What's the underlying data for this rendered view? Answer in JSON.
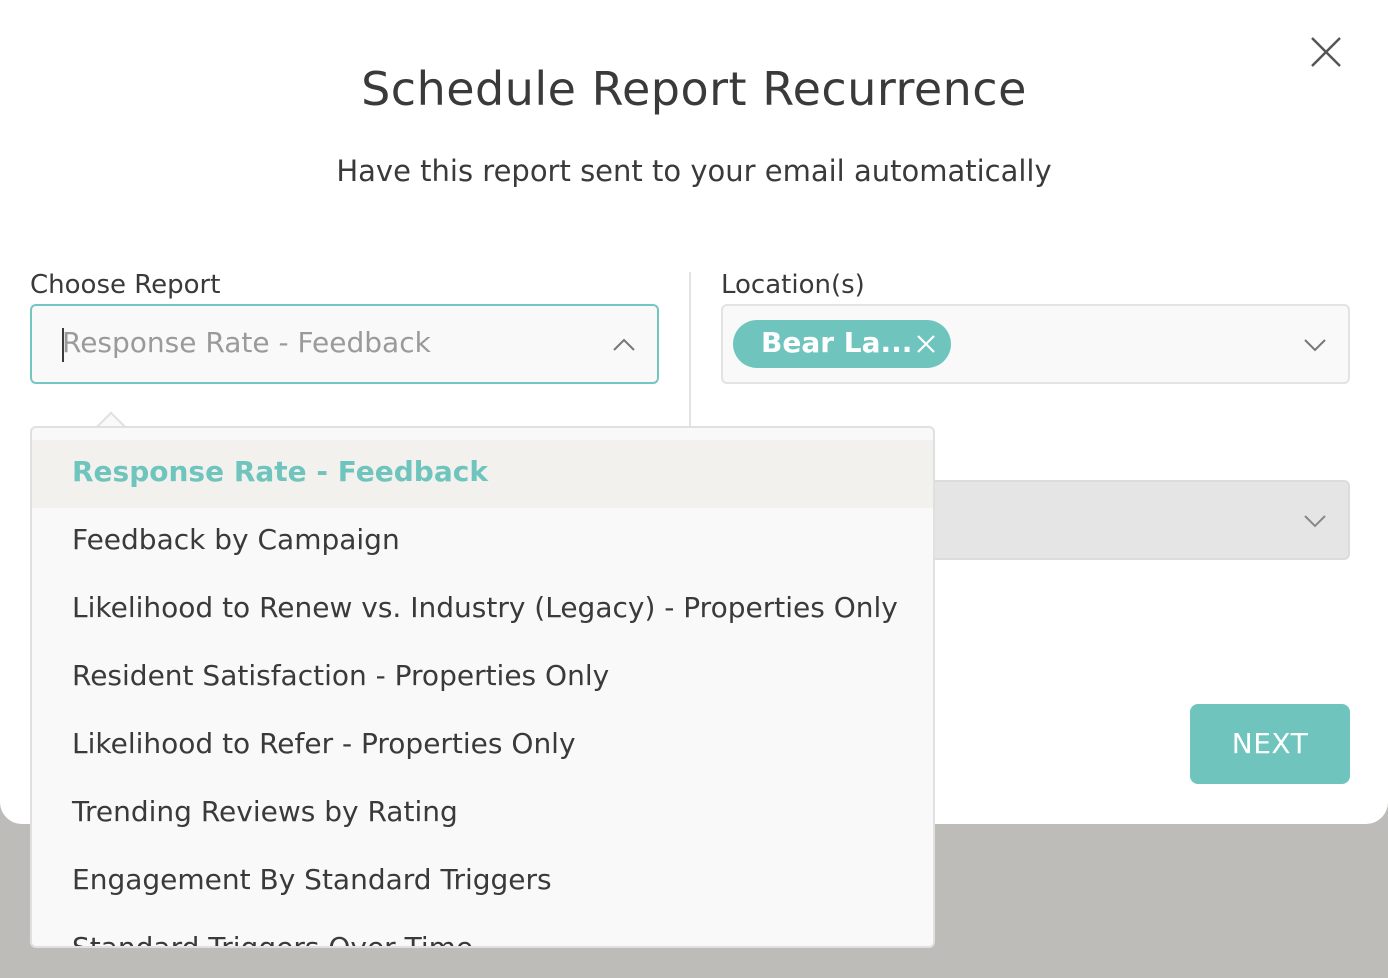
{
  "modal": {
    "title": "Schedule Report Recurrence",
    "subtitle": "Have this report sent to your email automatically",
    "close_icon": "close-icon"
  },
  "report_field": {
    "label": "Choose Report",
    "value": "Response Rate - Feedback",
    "chevron": "chevron-up-icon"
  },
  "location_field": {
    "label": "Location(s)",
    "chip_label": "Bear La...",
    "chip_remove_icon": "close-icon",
    "chevron": "chevron-down-icon"
  },
  "secondary_field": {
    "chevron": "chevron-down-icon"
  },
  "dropdown": {
    "options": [
      {
        "label": "Response Rate - Feedback",
        "selected": true
      },
      {
        "label": "Feedback by Campaign",
        "selected": false
      },
      {
        "label": "Likelihood to Renew vs. Industry (Legacy) - Properties Only",
        "selected": false
      },
      {
        "label": "Resident Satisfaction - Properties Only",
        "selected": false
      },
      {
        "label": "Likelihood to Refer - Properties Only",
        "selected": false
      },
      {
        "label": "Trending Reviews by Rating",
        "selected": false
      },
      {
        "label": "Engagement By Standard Triggers",
        "selected": false
      },
      {
        "label": "Standard Triggers Over Time",
        "selected": false
      }
    ]
  },
  "actions": {
    "next_label": "NEXT"
  },
  "colors": {
    "accent": "#6fc5bd",
    "text": "#3a3a3a",
    "overlay": "#bdbcb8"
  }
}
